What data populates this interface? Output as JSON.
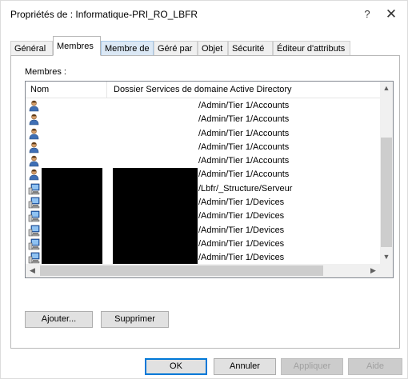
{
  "window": {
    "title": "Propriétés de : Informatique-PRI_RO_LBFR",
    "help_label": "?",
    "close_label": "✕"
  },
  "tabs": [
    {
      "label": "Général"
    },
    {
      "label": "Membres",
      "active": true
    },
    {
      "label": "Membre de"
    },
    {
      "label": "Géré par"
    },
    {
      "label": "Objet"
    },
    {
      "label": "Sécurité"
    },
    {
      "label": "Éditeur d'attributs"
    }
  ],
  "members": {
    "section_label": "Membres :",
    "columns": {
      "name": "Nom",
      "folder": "Dossier Services de domaine Active Directory"
    },
    "rows": [
      {
        "type": "user",
        "name": "",
        "folder": "/Admin/Tier 1/Accounts"
      },
      {
        "type": "user",
        "name": "",
        "folder": "/Admin/Tier 1/Accounts"
      },
      {
        "type": "user",
        "name": "",
        "folder": "/Admin/Tier 1/Accounts"
      },
      {
        "type": "user",
        "name": "",
        "folder": "/Admin/Tier 1/Accounts"
      },
      {
        "type": "user",
        "name": "",
        "folder": "/Admin/Tier 1/Accounts"
      },
      {
        "type": "user",
        "name": "",
        "folder": "/Admin/Tier 1/Accounts"
      },
      {
        "type": "computer",
        "name": "",
        "folder": "/Lbfr/_Structure/Serveur"
      },
      {
        "type": "computer",
        "name": "",
        "folder": "/Admin/Tier 1/Devices"
      },
      {
        "type": "computer",
        "name": "",
        "folder": "/Admin/Tier 1/Devices"
      },
      {
        "type": "computer",
        "name": "",
        "folder": "/Admin/Tier 1/Devices"
      },
      {
        "type": "computer",
        "name": "",
        "folder": "/Admin/Tier 1/Devices"
      },
      {
        "type": "computer",
        "name": "",
        "folder": "/Admin/Tier 1/Devices"
      },
      {
        "type": "computer",
        "name": "",
        "folder": "/Admin/Tier 1/Devices"
      }
    ]
  },
  "buttons": {
    "add": "Ajouter...",
    "remove": "Supprimer",
    "ok": "OK",
    "cancel": "Annuler",
    "apply": "Appliquer",
    "help": "Aide"
  },
  "icons": {
    "user": "user-icon",
    "computer": "computer-icon",
    "scroll_up": "chevron-up-icon",
    "scroll_down": "chevron-down-icon",
    "scroll_left": "chevron-left-icon",
    "scroll_right": "chevron-right-icon"
  },
  "colors": {
    "accent": "#0078d7",
    "tab_hover": "#dbe8f5",
    "redaction": "#000000"
  }
}
